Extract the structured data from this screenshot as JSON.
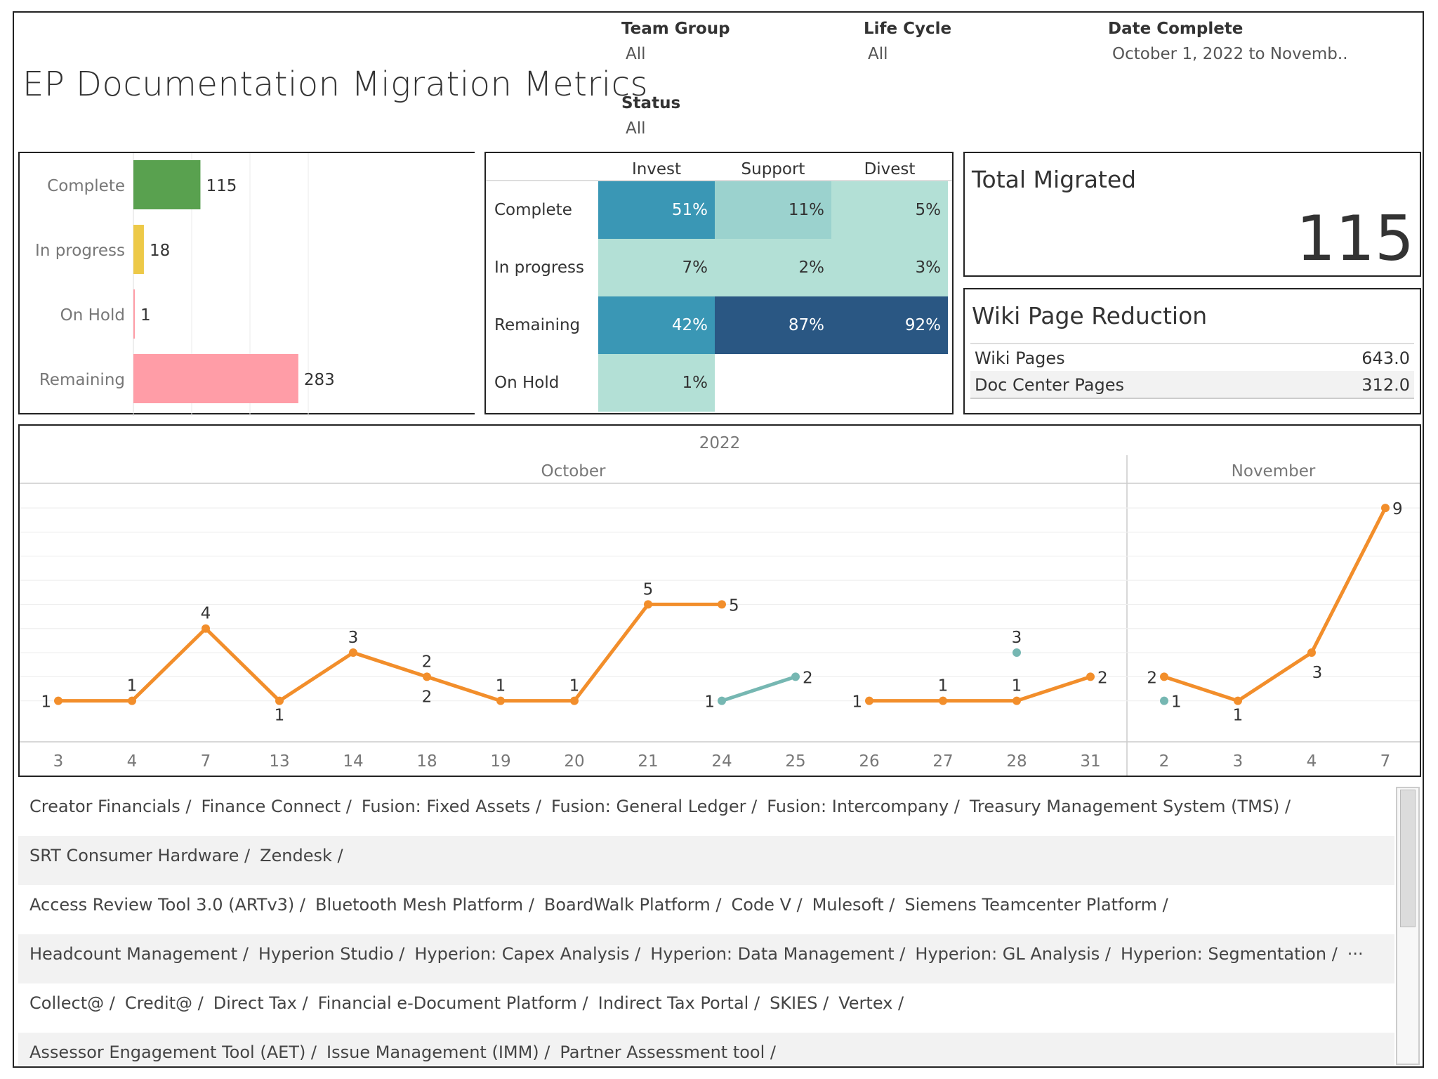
{
  "title": "EP Documentation Migration Metrics",
  "filters": [
    {
      "label": "Team Group",
      "value": "All"
    },
    {
      "label": "Life Cycle",
      "value": "All"
    },
    {
      "label": "Date Complete",
      "value": "October 1, 2022 to Novemb.."
    },
    {
      "label": "Status",
      "value": "All"
    }
  ],
  "kpi": {
    "title": "Total Migrated",
    "value": "115"
  },
  "wiki": {
    "title": "Wiki Page Reduction",
    "rows": [
      {
        "label": "Wiki Pages",
        "value": "643.0"
      },
      {
        "label": "Doc Center Pages",
        "value": "312.0"
      }
    ]
  },
  "chart_data": [
    {
      "type": "bar",
      "orientation": "horizontal",
      "categories": [
        "Complete",
        "In progress",
        "On Hold",
        "Remaining"
      ],
      "values": [
        115,
        18,
        1,
        283
      ],
      "colors": [
        "#59a14f",
        "#edc948",
        "#ff9da7",
        "#ff9da7"
      ],
      "xlim": [
        0,
        300
      ],
      "grid": true
    },
    {
      "type": "heatmap",
      "columns": [
        "Invest",
        "Support",
        "Divest"
      ],
      "rows": [
        "Complete",
        "In progress",
        "Remaining",
        "On Hold"
      ],
      "values": [
        [
          51,
          11,
          5
        ],
        [
          7,
          2,
          3
        ],
        [
          42,
          87,
          92
        ],
        [
          1,
          null,
          null
        ]
      ],
      "labels": [
        [
          "51%",
          "11%",
          "5%"
        ],
        [
          "7%",
          "2%",
          "3%"
        ],
        [
          "42%",
          "87%",
          "92%"
        ],
        [
          "1%",
          "",
          ""
        ]
      ]
    },
    {
      "type": "line",
      "year": "2022",
      "months": [
        {
          "name": "October",
          "days": [
            "3",
            "4",
            "7",
            "13",
            "14",
            "18",
            "19",
            "20",
            "21",
            "24",
            "25",
            "26",
            "27",
            "28",
            "31"
          ]
        },
        {
          "name": "November",
          "days": [
            "2",
            "3",
            "4",
            "7"
          ]
        }
      ],
      "ylim": [
        0,
        9.5
      ],
      "series": [
        {
          "color": "#f28e2b",
          "segments": [
            [
              [
                0,
                1
              ],
              [
                1,
                1
              ],
              [
                2,
                4
              ],
              [
                3,
                1
              ],
              [
                4,
                3
              ],
              [
                5,
                2
              ],
              [
                6,
                1
              ],
              [
                7,
                1
              ],
              [
                8,
                5
              ],
              [
                9,
                5
              ]
            ],
            [
              [
                11,
                1
              ],
              [
                12,
                1
              ],
              [
                13,
                1
              ],
              [
                14,
                2
              ]
            ],
            [
              [
                15,
                2
              ],
              [
                16,
                1
              ],
              [
                17,
                3
              ],
              [
                18,
                9
              ]
            ]
          ]
        },
        {
          "color": "#76b7b2",
          "segments": [
            [
              [
                9,
                1
              ],
              [
                10,
                2
              ]
            ],
            [
              [
                13,
                3
              ]
            ],
            [
              [
                15,
                1
              ]
            ]
          ]
        }
      ],
      "extra_labels": [
        {
          "index": 5,
          "value": "2"
        }
      ]
    }
  ],
  "apps": [
    [
      "Creator Financials /",
      "Finance Connect /",
      "Fusion: Fixed Assets /",
      "Fusion: General Ledger /",
      "Fusion: Intercompany /",
      "Treasury Management System (TMS) /"
    ],
    [
      "SRT Consumer Hardware /",
      "Zendesk /"
    ],
    [
      "Access Review Tool 3.0 (ARTv3) /",
      "Bluetooth Mesh Platform /",
      "BoardWalk Platform /",
      "Code V /",
      "Mulesoft /",
      "Siemens Teamcenter Platform /"
    ],
    [
      "Headcount Management /",
      "Hyperion Studio /",
      "Hyperion: Capex Analysis /",
      "Hyperion: Data Management /",
      "Hyperion: GL Analysis /",
      "Hyperion: Segmentation /",
      "···"
    ],
    [
      "Collect@ /",
      "Credit@ /",
      "Direct Tax /",
      "Financial e-Document Platform /",
      "Indirect Tax Portal /",
      "SKIES /",
      "Vertex /"
    ],
    [
      "Assessor Engagement Tool (AET) /",
      "Issue Management (IMM) /",
      "Partner Assessment tool /"
    ]
  ]
}
